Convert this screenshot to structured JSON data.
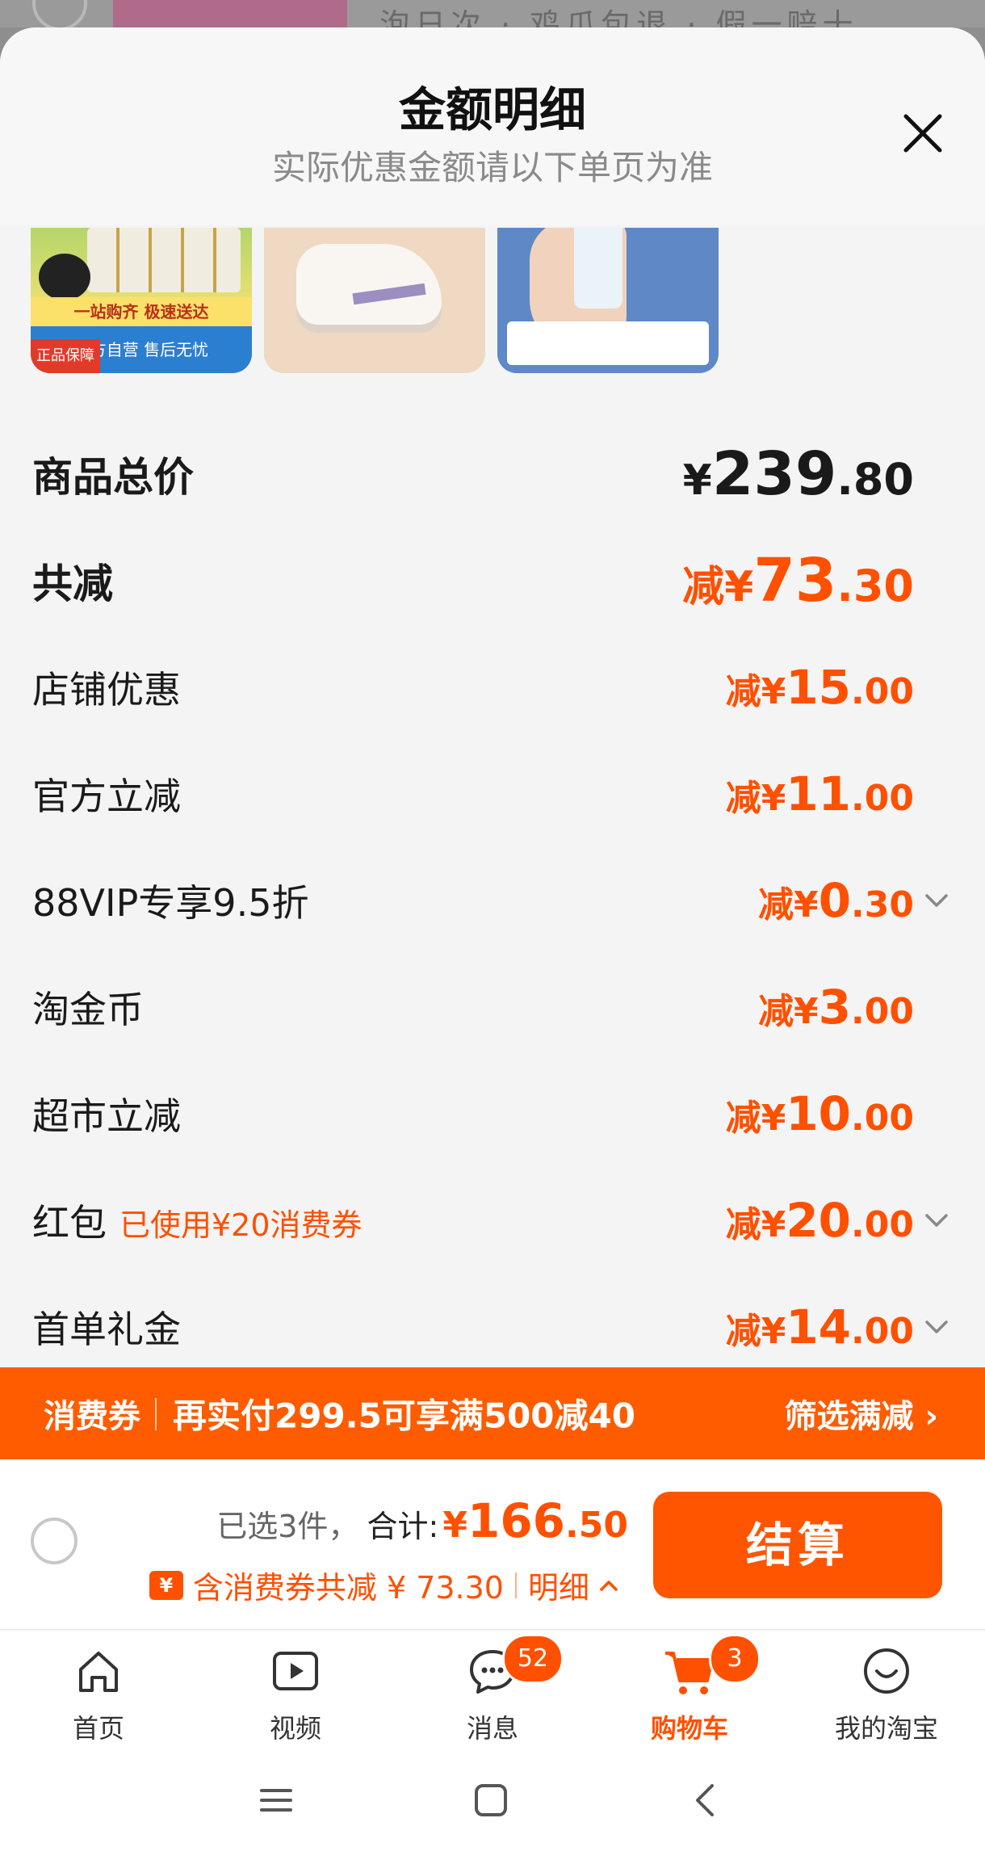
{
  "backdrop": {
    "text": "泡日次 · 鸡爪包退 · 假一赔十"
  },
  "sheet": {
    "title": "金额明细",
    "subtitle": "实际优惠金额请以下单页为准",
    "close_icon": "close-icon"
  },
  "thumbnails": [
    {
      "band_top": "一站购齐 极速送达",
      "band_bottom": "官方自营 售后无忧",
      "badge": "正品保障"
    },
    {},
    {}
  ],
  "rows": {
    "total": {
      "label": "商品总价",
      "prefix": "¥",
      "int": "239",
      "dec": ".80"
    },
    "reduced": {
      "label": "共减",
      "prefix": "减¥",
      "int": "73",
      "dec": ".30"
    },
    "shop": {
      "label": "店铺优惠",
      "prefix": "减¥",
      "int": "15",
      "dec": ".00"
    },
    "official": {
      "label": "官方立减",
      "prefix": "减¥",
      "int": "11",
      "dec": ".00"
    },
    "vip": {
      "label": "88VIP专享9.5折",
      "prefix": "减¥",
      "int": "0",
      "dec": ".30"
    },
    "coins": {
      "label": "淘金币",
      "prefix": "减¥",
      "int": "3",
      "dec": ".00"
    },
    "market": {
      "label": "超市立减",
      "prefix": "减¥",
      "int": "10",
      "dec": ".00"
    },
    "redpack": {
      "label": "红包",
      "note": "已使用¥20消费券",
      "prefix": "减¥",
      "int": "20",
      "dec": ".00"
    },
    "firstorder": {
      "label": "首单礼金",
      "prefix": "减¥",
      "int": "14",
      "dec": ".00"
    }
  },
  "promo_bar": {
    "tag": "消费券",
    "message": "再实付299.5可享满500减40",
    "action": "筛选满减 ›"
  },
  "checkout": {
    "selected": "已选3件，",
    "total_label": "合计:",
    "total_prefix": "¥",
    "total_int": "166",
    "total_dec": ".50",
    "coupon_icon_text": "¥",
    "discount_text": "含消费券共减 ¥ 73.30",
    "detail_label": "明细",
    "pay_label": "结算"
  },
  "tabbar": [
    {
      "label": "首页",
      "icon": "home-icon"
    },
    {
      "label": "视频",
      "icon": "video-icon"
    },
    {
      "label": "消息",
      "icon": "message-icon",
      "badge": "52"
    },
    {
      "label": "购物车",
      "icon": "cart-icon",
      "badge": "3",
      "active": true
    },
    {
      "label": "我的淘宝",
      "icon": "profile-icon"
    }
  ],
  "colors": {
    "accent": "#ff5000",
    "promo_bar": "#ff5c00",
    "pay_button": "#ff5500"
  }
}
